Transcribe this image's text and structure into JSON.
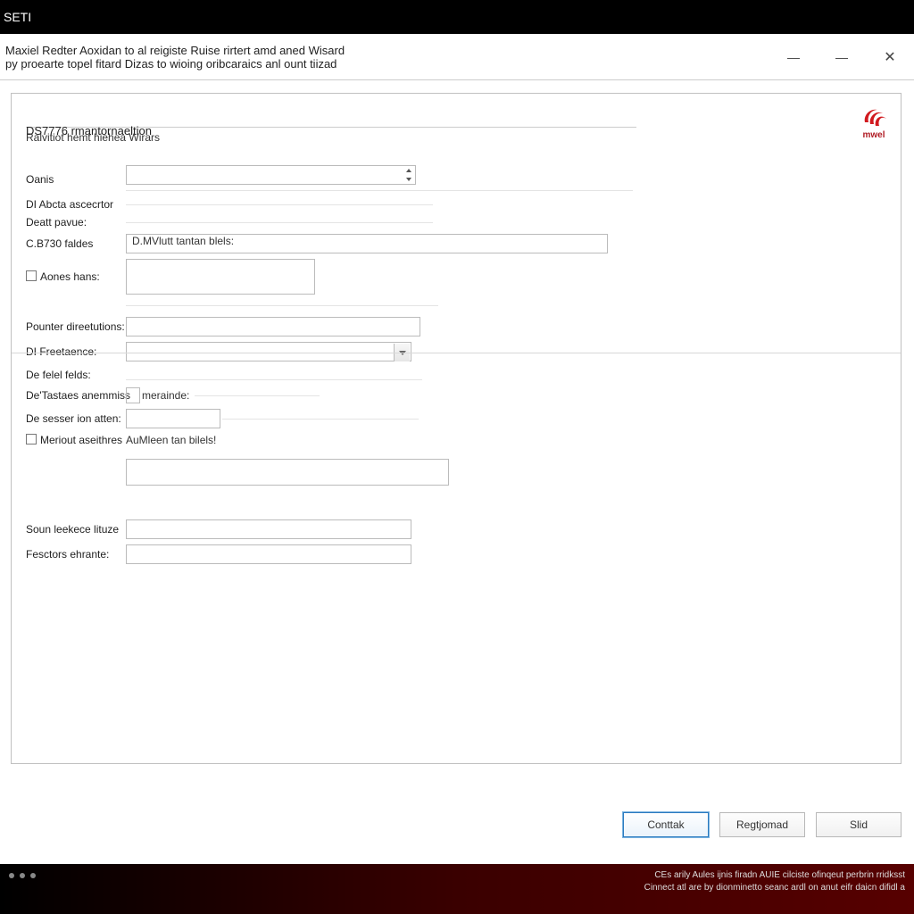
{
  "top_strip": {
    "label": "SETI"
  },
  "titlebar": {
    "line1": "Maxiel Redter Aoxidan to al reigiste Ruise rirtert amd aned Wisard",
    "line2": "py proearte topel fitard Dizas to wioing oribcaraics anl ount tiizad"
  },
  "brand": {
    "name": "mwel"
  },
  "section": {
    "title": "DS7776 rmantornaeltion",
    "subtitle": "Ralvitiot hemt hiehea Wirars"
  },
  "fields": {
    "oanis": "Oanis",
    "abcta_ascecrtor": "DI Abcta ascecrtor",
    "deatt_pavue": "Deatt pavue:",
    "c3730_faldes": "C.B730 faldes",
    "c3730_inline": "D.MVlutt tantan blels:",
    "aones_hans": "Aones hans:",
    "pounter_direetions": "Pounter direetutions:",
    "freetaence": "DI Freetaence:",
    "de_felel_felds": "De felel felds:",
    "de_tastaes": "De'Tastaes anemmiss",
    "de_tastaes_inline": "merainde:",
    "de_sesser_ion": "De sesser ion atten:",
    "meriout_aseithres": "Meriout aseithres",
    "meriout_inline": "AuMleen tan bilels!",
    "soun_leekece": "Soun leekece lituze",
    "fesctors_ehrante": "Fesctors ehrante:"
  },
  "buttons": {
    "continue": "Conttak",
    "register": "Regtjomad",
    "skip": "Slid"
  },
  "footer": {
    "line1": "CEs arily Aules ijnis firadn AUIE cilciste ofinqeut perbrin rridksst",
    "line2": "Cinnect atl are by dionminetto seanc ardl on anut eifr daicn difidl a"
  }
}
